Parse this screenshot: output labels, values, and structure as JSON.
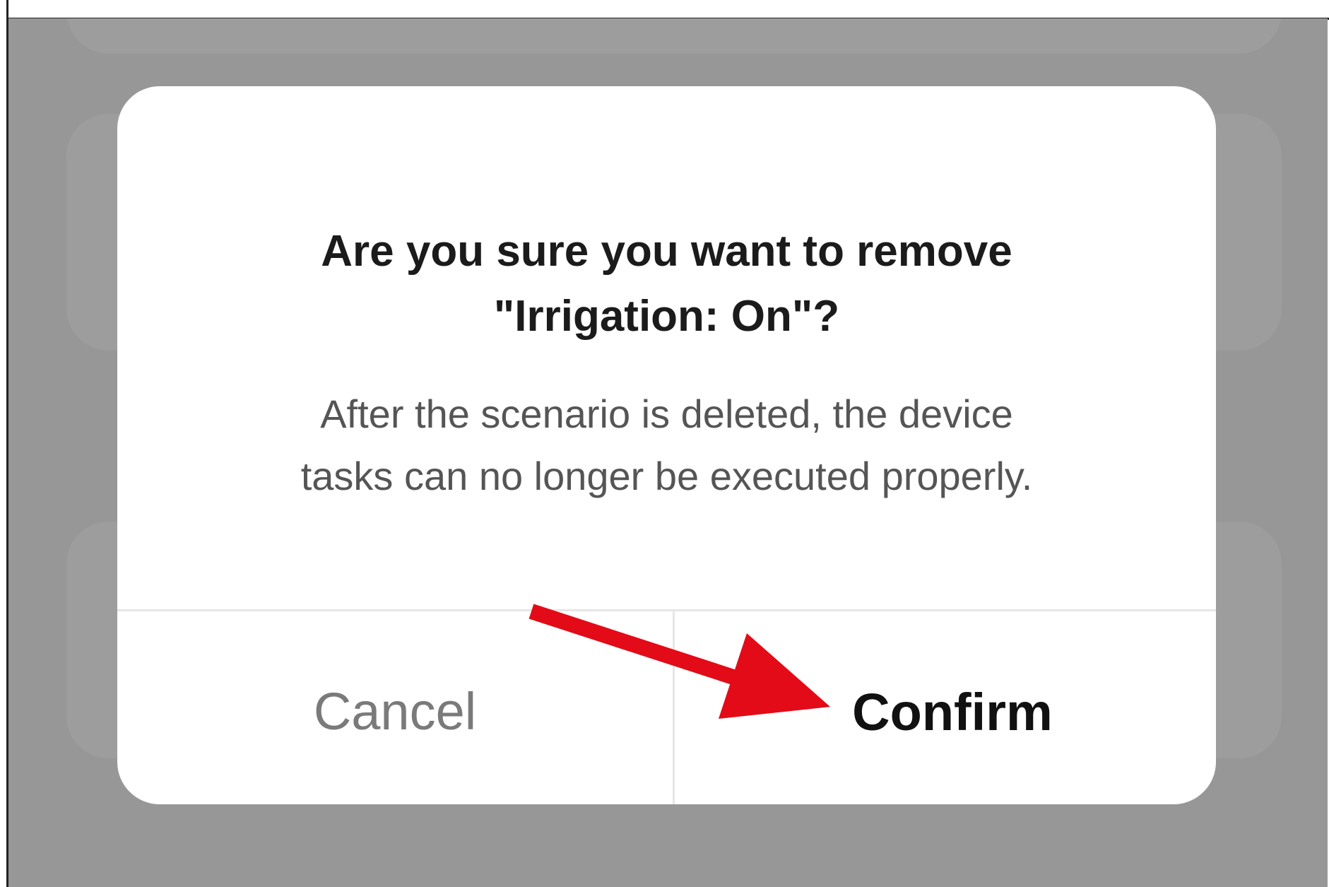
{
  "dialog": {
    "title_line1": "Are you sure you want to remove",
    "title_line2": "\"Irrigation: On\"?",
    "message_line1": "After the scenario is deleted, the device",
    "message_line2": "tasks can no longer be executed properly.",
    "cancel_label": "Cancel",
    "confirm_label": "Confirm"
  },
  "annotation": {
    "arrow_color": "#e20b17",
    "points_to": "confirm-button"
  },
  "colors": {
    "overlay": "#979797",
    "dialog_background": "#ffffff",
    "title_text": "#1b1b1b",
    "message_text": "#555555",
    "cancel_text": "#7a7a7a",
    "confirm_text": "#111111"
  }
}
